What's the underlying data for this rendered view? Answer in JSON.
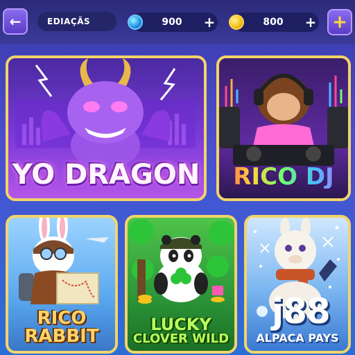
{
  "topbar": {
    "back_label": "←",
    "breadcrumb": "EDIAÇÃS",
    "gems": {
      "icon": "blue-gem-icon",
      "amount": "900",
      "plus": "+"
    },
    "coins": {
      "icon": "gold-coin-icon",
      "amount": "800",
      "plus": "+"
    },
    "add_label": "+"
  },
  "games": [
    {
      "title": "YO DRAGON"
    },
    {
      "title": "RICO DJ"
    },
    {
      "title_line1": "RICO",
      "title_line2": "RABBIT"
    },
    {
      "title_line1": "LUCKY",
      "title_line2": "CLOVER WILD"
    },
    {
      "title": "ALPACA PAYS"
    }
  ],
  "watermark": "j88",
  "colors": {
    "card_border": "#f2d46a",
    "accent": "#5a3cc8",
    "background": "#3b3aa8"
  }
}
